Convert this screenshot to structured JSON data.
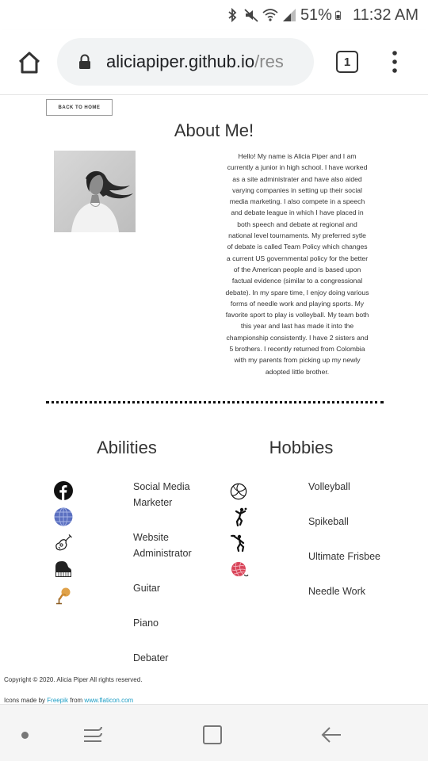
{
  "status": {
    "battery": "51%",
    "time": "11:32 AM",
    "icons": [
      "bluetooth-icon",
      "mute-icon",
      "wifi-icon",
      "signal-icon",
      "battery-icon"
    ]
  },
  "browser": {
    "url_host": "aliciapiper.github.io",
    "url_path": "/res",
    "tab_count": "1"
  },
  "page": {
    "back_button": "BACK TO HOME",
    "about_title": "About Me!",
    "bio_lines": [
      "Hello! My name is Alicia Piper and I am",
      "currently a junior in high school. I have worked",
      "as a site administrater and have also aided",
      "varying companies in setting up their social",
      "media marketing. I also compete in a speech",
      "and debate league in which I have placed in",
      "both speech and debate at regional and",
      "national level tournaments. My preferred sytle",
      "of debate is called Team Policy which changes",
      "a current US governmental policy for the better",
      "of the American people and is based upon",
      "factual evidence (similar to a congressional",
      "debate). In my spare time, I enjoy doing various",
      "forms of needle work and playing sports. My",
      "favorite sport to play is volleyball. My team both",
      "this year and last has made it into the",
      "championship consistently. I have 2 sisters and",
      "5 brothers. I recently returned from Colombia",
      "with my parents from picking up my newly",
      "adopted little brother."
    ],
    "abilities_title": "Abilities",
    "hobbies_title": "Hobbies",
    "abilities": [
      {
        "line1": "Social Media",
        "line2": "Marketer",
        "icon": "facebook-icon"
      },
      {
        "line1": "Website",
        "line2": "Administrator",
        "icon": "globe-icon"
      },
      {
        "line1": "Guitar",
        "line2": "",
        "icon": "guitar-icon"
      },
      {
        "line1": "Piano",
        "line2": "",
        "icon": "piano-icon"
      },
      {
        "line1": "Debater",
        "line2": "",
        "icon": "microphone-icon"
      }
    ],
    "hobbies": [
      {
        "label": "Volleyball",
        "icon": "volleyball-icon"
      },
      {
        "label": "Spikeball",
        "icon": "spikeball-player-icon"
      },
      {
        "label": "Ultimate Frisbee",
        "icon": "frisbee-player-icon"
      },
      {
        "label": "Needle Work",
        "icon": "yarn-ball-icon"
      }
    ],
    "copyright": "Copyright © 2020. Alicia Piper All rights reserved.",
    "credits_prefix": "Icons made by",
    "credits_author": "Freepik",
    "credits_from": "from",
    "credits_site": "www.flaticon.com"
  },
  "colors": {
    "link": "#1b9dc4",
    "globe": "#5a6fc0",
    "microphone": "#d4923a",
    "yarn": "#d9455a"
  }
}
